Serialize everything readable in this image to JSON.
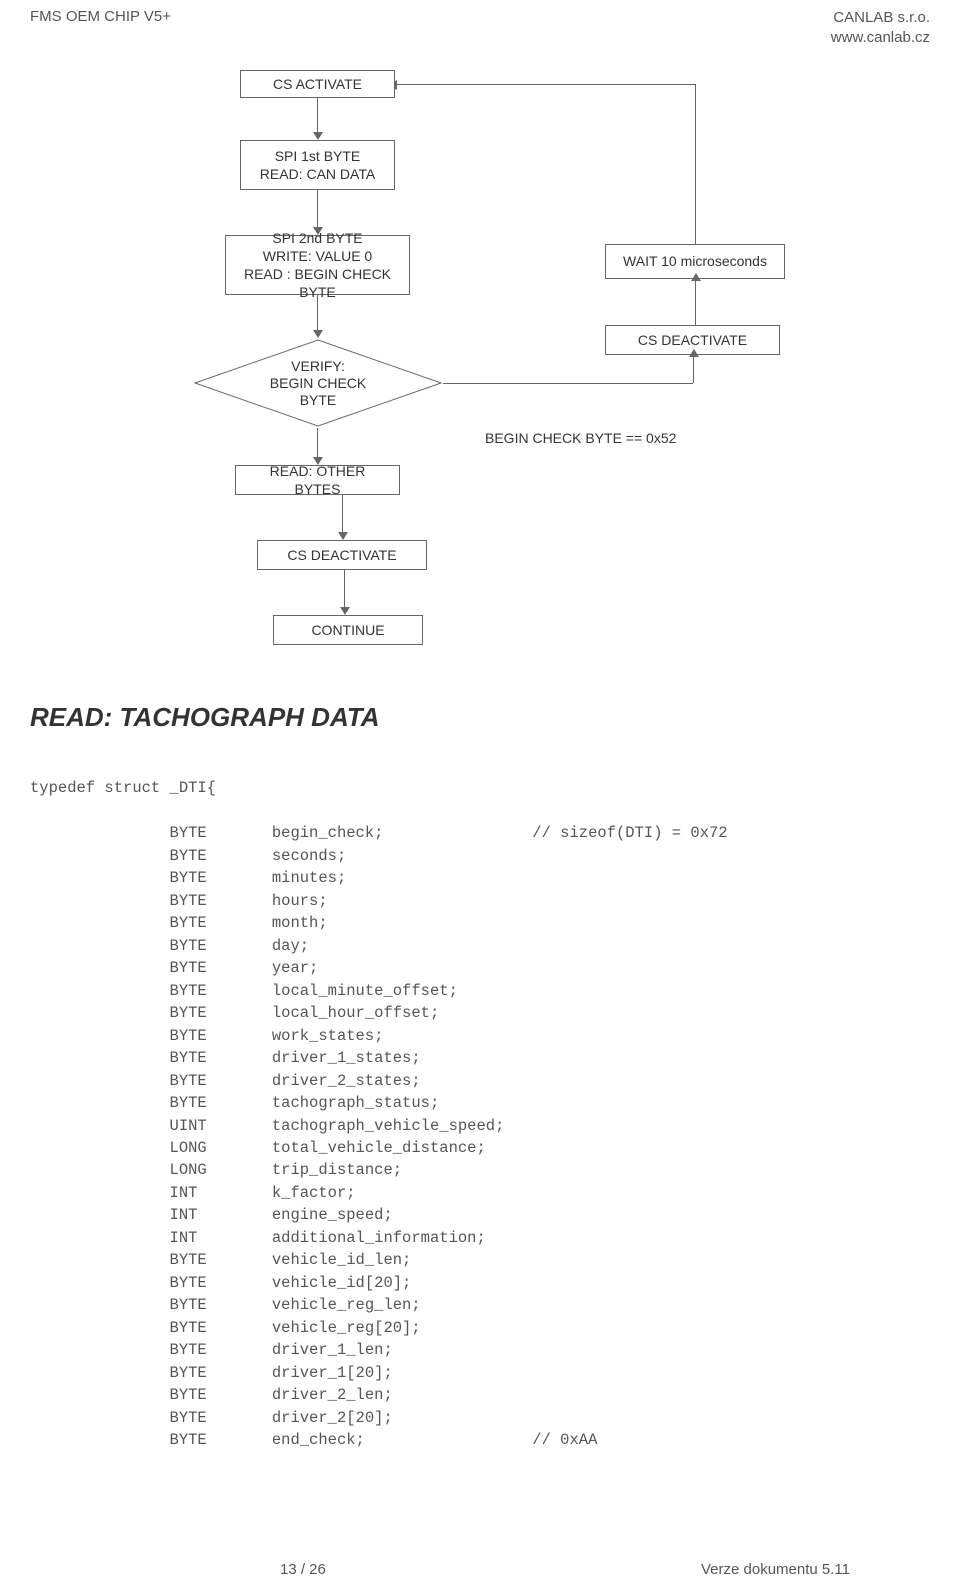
{
  "header": {
    "left": "FMS OEM CHIP V5+",
    "right1": "CANLAB s.r.o.",
    "right2": "www.canlab.cz"
  },
  "flow": {
    "cs_activate": "CS ACTIVATE",
    "spi1": "SPI 1st BYTE\nREAD: CAN DATA",
    "spi2": "SPI 2nd BYTE\nWRITE: VALUE 0\nREAD : BEGIN CHECK\nBYTE",
    "wait": "WAIT 10 microseconds",
    "cs_deactivate": "CS DEACTIVATE",
    "verify": "VERIFY:\nBEGIN CHECK\nBYTE",
    "cond_label": "BEGIN CHECK BYTE == 0x52",
    "read_other": "READ: OTHER BYTES",
    "cs_deactivate2": "CS DEACTIVATE",
    "continue": "CONTINUE"
  },
  "section": {
    "title": "READ: TACHOGRAPH DATA"
  },
  "code": {
    "typedef": "typedef struct _DTI{",
    "comment1": "// sizeof(DTI) = 0x72",
    "comment2": "// 0xAA",
    "rows": [
      {
        "type": "BYTE",
        "field": "begin_check;",
        "comment": "// sizeof(DTI) = 0x72"
      },
      {
        "type": "BYTE",
        "field": "seconds;"
      },
      {
        "type": "BYTE",
        "field": "minutes;"
      },
      {
        "type": "BYTE",
        "field": "hours;"
      },
      {
        "type": "BYTE",
        "field": "month;"
      },
      {
        "type": "BYTE",
        "field": "day;"
      },
      {
        "type": "BYTE",
        "field": "year;"
      },
      {
        "type": "BYTE",
        "field": "local_minute_offset;"
      },
      {
        "type": "BYTE",
        "field": "local_hour_offset;"
      },
      {
        "type": "BYTE",
        "field": "work_states;"
      },
      {
        "type": "BYTE",
        "field": "driver_1_states;"
      },
      {
        "type": "BYTE",
        "field": "driver_2_states;"
      },
      {
        "type": "BYTE",
        "field": "tachograph_status;"
      },
      {
        "type": "UINT",
        "field": "tachograph_vehicle_speed;"
      },
      {
        "type": "LONG",
        "field": "total_vehicle_distance;"
      },
      {
        "type": "LONG",
        "field": "trip_distance;"
      },
      {
        "type": "INT",
        "field": "k_factor;"
      },
      {
        "type": "INT",
        "field": "engine_speed;"
      },
      {
        "type": "INT",
        "field": "additional_information;"
      },
      {
        "type": "BYTE",
        "field": "vehicle_id_len;"
      },
      {
        "type": "BYTE",
        "field": "vehicle_id[20];"
      },
      {
        "type": "BYTE",
        "field": "vehicle_reg_len;"
      },
      {
        "type": "BYTE",
        "field": "vehicle_reg[20];"
      },
      {
        "type": "BYTE",
        "field": "driver_1_len;"
      },
      {
        "type": "BYTE",
        "field": "driver_1[20];"
      },
      {
        "type": "BYTE",
        "field": "driver_2_len;"
      },
      {
        "type": "BYTE",
        "field": "driver_2[20];"
      },
      {
        "type": "BYTE",
        "field": "end_check;",
        "comment": "// 0xAA"
      }
    ]
  },
  "footer": {
    "left": "13 / 26",
    "right": "Verze dokumentu 5.11"
  }
}
